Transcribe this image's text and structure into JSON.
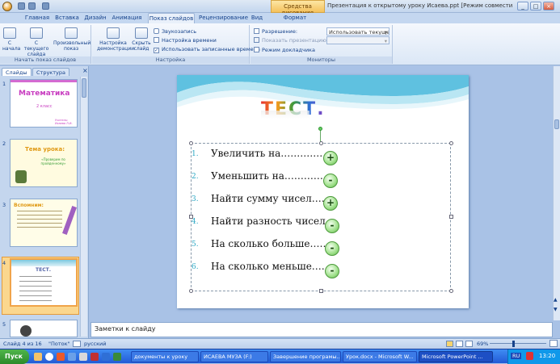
{
  "window": {
    "title": "Презентация к открытому уроку Исаева.ppt [Режим совместимости] - Microsoft PowerPoint",
    "context_tool": "Средства рисования",
    "controls": [
      "_",
      "□",
      "×"
    ]
  },
  "tabs": [
    {
      "label": "Главная"
    },
    {
      "label": "Вставка"
    },
    {
      "label": "Дизайн"
    },
    {
      "label": "Анимация"
    },
    {
      "label": "Показ слайдов",
      "active": true
    },
    {
      "label": "Рецензирование"
    },
    {
      "label": "Вид"
    },
    {
      "label": "Формат"
    }
  ],
  "ribbon": {
    "start_group": {
      "label": "Начать показ слайдов",
      "buttons": [
        "С начала",
        "С текущего слайда",
        "Произвольный показ"
      ]
    },
    "setup_group": {
      "label": "Настройка",
      "buttons": [
        "Настройка демонстрации",
        "Скрыть слайд"
      ],
      "small": [
        "Звукозапись",
        "Настройка времени",
        "Использовать записанные времена"
      ]
    },
    "monitors_group": {
      "label": "Мониторы",
      "resolution_label": "Разрешение:",
      "resolution_value": "Использовать текуще...",
      "show_on_label": "Показать презентацию на:",
      "show_on_value": "",
      "presenter_mode": "Режим докладчика"
    }
  },
  "panel_tabs": [
    "Слайды",
    "Структура"
  ],
  "thumbnails": [
    {
      "num": "1",
      "title": "Математика",
      "subtitle": "2 класс",
      "author": "Учитель: Исаева Л.И."
    },
    {
      "num": "2",
      "title": "Тема урока:",
      "subtitle": "«Проверим по пройденному»"
    },
    {
      "num": "3",
      "title": "Вспомним:"
    },
    {
      "num": "4",
      "title": "ТЕСТ."
    },
    {
      "num": "5"
    }
  ],
  "slide": {
    "title": "ТЕСТ.",
    "items": [
      {
        "num": "1.",
        "text": "Увеличить на……………",
        "sign": "+"
      },
      {
        "num": "2.",
        "text": "Уменьшить на……………",
        "sign": "-"
      },
      {
        "num": "3.",
        "text": "Найти сумму чисел……",
        "sign": "+"
      },
      {
        "num": "4.",
        "text": "Найти разность чисел…",
        "sign": "-"
      },
      {
        "num": "5.",
        "text": "На сколько больше………",
        "sign": "-"
      },
      {
        "num": "6.",
        "text": "На сколько меньше……",
        "sign": "-"
      }
    ]
  },
  "notes_placeholder": "Заметки к слайду",
  "status": {
    "slide_info": "Слайд 4 из 16",
    "theme": "\"Поток\"",
    "language": "русский",
    "zoom": "69%"
  },
  "taskbar": {
    "start": "Пуск",
    "tasks": [
      "документы к уроку",
      "ИСАЕВА МУЗА (F:)",
      "Завершение програмы...",
      "Урок.docx - Microsoft W...",
      "Microsoft PowerPoint ..."
    ],
    "lang": "RU",
    "clock": "13:20"
  },
  "colors": {
    "accent": "#2aa7c4",
    "selection": "#f0a44a",
    "ribbon": "#dbe7f6"
  }
}
